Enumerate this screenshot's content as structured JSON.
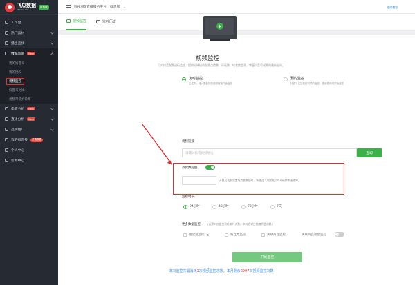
{
  "brand": {
    "name": "飞瓜数据",
    "sub": "FEIGUA.CN",
    "badge": "抖音版"
  },
  "sidebar": {
    "items": [
      {
        "label": "工作台"
      },
      {
        "label": "热门素材"
      },
      {
        "label": "播主查找"
      },
      {
        "label": "数据监测",
        "badge": "New"
      },
      {
        "label": "电商分析",
        "badge": "New"
      },
      {
        "label": "直播分析",
        "badge": "New"
      },
      {
        "label": "品牌推广"
      },
      {
        "label": "我的抖音号",
        "badge": "开通数据"
      },
      {
        "label": "个人中心"
      },
      {
        "label": "帮助中心"
      }
    ],
    "sub_items": [
      {
        "label": "我的抖音号"
      },
      {
        "label": "我的授权"
      },
      {
        "label": "视频监控"
      },
      {
        "label": "抖音号对比"
      },
      {
        "label": "视频带货力诊断"
      }
    ]
  },
  "topbar": {
    "title": "短视频&直播服务平台",
    "platform": "抖音版"
  },
  "tabs": [
    {
      "label": "视频监控"
    },
    {
      "label": "监控历史"
    }
  ],
  "main": {
    "help_link": "使用教程",
    "title": "视频监控",
    "description": "可对抖音视频进行监控，提供分钟级的视频点赞数、评论数、转发数监测，掌握抖音号视频的最新走向。",
    "modes": [
      {
        "title": "定时监控",
        "desc": "已发布，输入要监控的视频链接开始监控"
      },
      {
        "title": "预约监控",
        "desc": "抖音号已授权即可预约监控，视频发布时开始监控"
      }
    ],
    "video_link_label": "视频链接",
    "video_link_placeholder": "请输入抖音视频地址",
    "query_button": "查询",
    "alert_label": "点赞数提醒",
    "alert_input_placeholder": "",
    "alert_text": "开启后达到设置的点赞数值时，将通过飞瓜数据公众号给你发送通知。",
    "duration_label": "监控时长",
    "durations": [
      "24小时",
      "48小时",
      "72小时",
      "7天"
    ],
    "more_label": "更多数据监控",
    "more_note": "(选择对应监控消耗额外次数，未勾选对应额度将会消耗)",
    "more_options": [
      "播放量监控",
      "粉丝数监控",
      "关联商品监控",
      "关联商品销量监控"
    ],
    "start_button": "开始监控",
    "footer_prefix": "本次监控共需消耗",
    "footer_cost": "1",
    "footer_mid": "次视频监控次数，本月剩余",
    "footer_remain": "2997",
    "footer_suffix": "次视频监控次数"
  },
  "colors": {
    "accent": "#3cb14a",
    "sidebar": "#262a33",
    "highlight": "#e0302e"
  }
}
